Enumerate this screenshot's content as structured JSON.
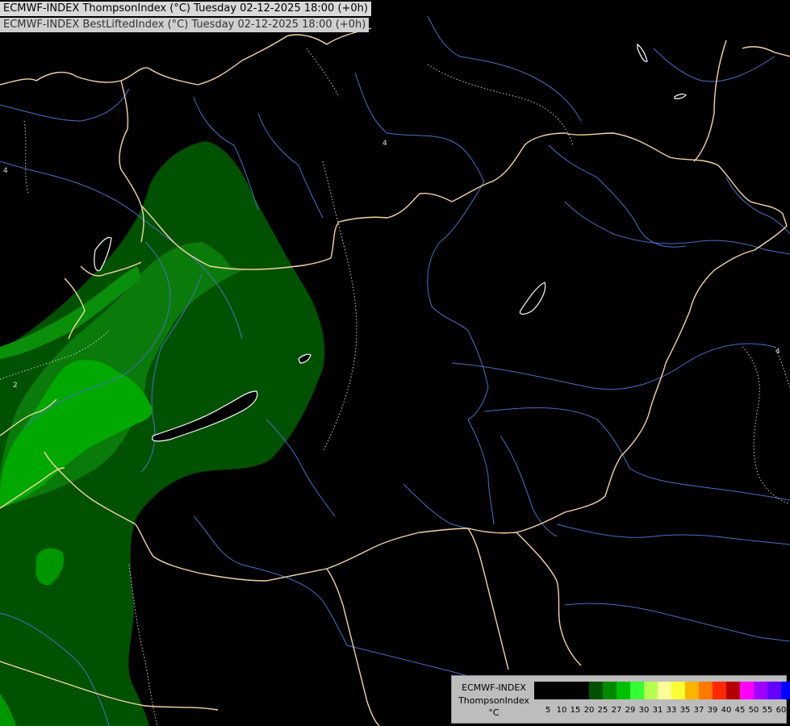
{
  "header": {
    "title_primary": "ECMWF-INDEX ThompsonIndex (°C) Tuesday 02-12-2025 18:00 (+0h)",
    "title_secondary": "ECMWF-INDEX BestLiftedIndex (°C) Tuesday 02-12-2025 18:00 (+0h)"
  },
  "map": {
    "background_color": "#000000",
    "border_color": "#f5d5a8",
    "river_color": "#4a6fc8",
    "contour_color": "#cfcfcf",
    "contour_labels": [
      "4",
      "2",
      "4",
      "4"
    ],
    "fill_levels": [
      {
        "class": "20-25",
        "color": "#005200"
      },
      {
        "class": "25-27",
        "color": "#0a8f0a"
      },
      {
        "class": "27-29",
        "color": "#00b400"
      }
    ]
  },
  "legend": {
    "model": "ECMWF-INDEX",
    "parameter": "ThompsonIndex",
    "unit": "°C",
    "ticks": [
      "5",
      "10",
      "15",
      "20",
      "25",
      "27",
      "29",
      "30",
      "31",
      "33",
      "35",
      "37",
      "39",
      "40",
      "45",
      "50",
      "55",
      "60"
    ],
    "colors": [
      "#000000",
      "#000000",
      "#000000",
      "#000000",
      "#005200",
      "#008a00",
      "#00c000",
      "#33ff33",
      "#b4ff50",
      "#ffff99",
      "#ffff33",
      "#ffb400",
      "#ff7800",
      "#ff2800",
      "#b40000",
      "#ff00ff",
      "#a000ff",
      "#6400ff",
      "#0000ff"
    ]
  }
}
